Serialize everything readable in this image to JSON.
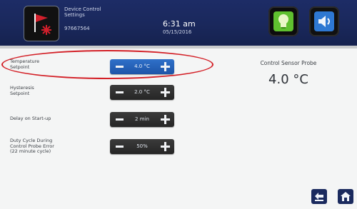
{
  "header": {
    "device_title": "Device Control\nSettings",
    "device_id": "97667564",
    "time": "6:31 am",
    "date": "05/15/2016"
  },
  "settings": [
    {
      "label": "Temperature\nSetpoint",
      "value": "4.0 °C",
      "active": true
    },
    {
      "label": "Hysteresis\nSetpoint",
      "value": "2.0 °C",
      "active": false
    },
    {
      "label": "Delay on Start-up",
      "value": "2 min",
      "active": false
    },
    {
      "label": "Duty Cycle During\nControl Probe Error\n(22 minute cycle)",
      "value": "50%",
      "active": false
    }
  ],
  "probe": {
    "title": "Control Sensor Probe",
    "value": "4.0 °C"
  },
  "colors": {
    "header_bg": "#1b2a5f",
    "active_stepper": "#2a64bd",
    "stepper": "#303030",
    "highlight_ring": "#d31f26",
    "bulb_green": "#5fc02f",
    "sound_blue": "#2e78d2"
  },
  "icons": {
    "alarm": "flag-alarm-icon",
    "light": "light-bulb-icon",
    "sound": "speaker-icon",
    "back": "back-arrow-icon",
    "home": "home-icon"
  }
}
